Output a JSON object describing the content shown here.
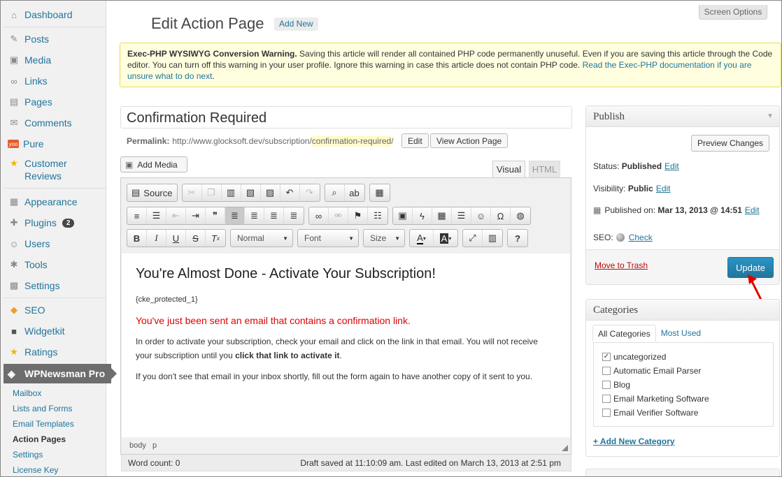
{
  "sidebar": {
    "items": [
      {
        "label": "Dashboard",
        "icon": "dashboard-icon",
        "glyph": "⌂"
      },
      {
        "label": "Posts",
        "icon": "pin-icon",
        "glyph": "✎"
      },
      {
        "label": "Media",
        "icon": "media-icon",
        "glyph": "▣"
      },
      {
        "label": "Links",
        "icon": "link-icon",
        "glyph": "∞"
      },
      {
        "label": "Pages",
        "icon": "pages-icon",
        "glyph": "▤"
      },
      {
        "label": "Comments",
        "icon": "comment-icon",
        "glyph": "✉"
      },
      {
        "label": "Pure",
        "icon": "yoo-icon",
        "glyph": "●"
      },
      {
        "label": "Customer",
        "label2": "Reviews",
        "icon": "star-icon",
        "glyph": "★"
      },
      {
        "label": "Appearance",
        "icon": "appearance-icon",
        "glyph": "▦"
      },
      {
        "label": "Plugins",
        "icon": "plugin-icon",
        "glyph": "✚",
        "badge": "2"
      },
      {
        "label": "Users",
        "icon": "users-icon",
        "glyph": "☺"
      },
      {
        "label": "Tools",
        "icon": "tools-icon",
        "glyph": "✱"
      },
      {
        "label": "Settings",
        "icon": "settings-icon",
        "glyph": "▩"
      },
      {
        "label": "SEO",
        "icon": "seo-icon",
        "glyph": "◆"
      },
      {
        "label": "Widgetkit",
        "icon": "widgetkit-icon",
        "glyph": "■"
      },
      {
        "label": "Ratings",
        "icon": "ratings-star-icon",
        "glyph": "★"
      }
    ],
    "active": {
      "label": "WPNewsman Pro",
      "icon": "newsman-icon"
    },
    "submenu": [
      "Mailbox",
      "Lists and Forms",
      "Email Templates",
      "Action Pages",
      "Settings",
      "License Key"
    ]
  },
  "header": {
    "screen_options": "Screen Options",
    "title": "Edit Action Page",
    "add_new": "Add New"
  },
  "warning": {
    "bold": "Exec-PHP WYSIWYG Conversion Warning.",
    "text": " Saving this article will render all contained PHP code permanently unuseful. Even if you are saving this article through the Code editor. You can turn off this warning in your user profile. Ignore this warning in case this article does not contain PHP code. ",
    "link": "Read the Exec-PHP documentation if you are unsure what to do next",
    "end": "."
  },
  "post": {
    "title": "Confirmation Required",
    "permalink_label": "Permalink:",
    "permalink_base": "http://www.glocksoft.dev/subscription/",
    "permalink_slug": "confirmation-required",
    "permalink_end": "/",
    "edit_btn": "Edit",
    "view_btn": "View Action Page"
  },
  "editor": {
    "add_media": "Add Media",
    "tab_visual": "Visual",
    "tab_html": "HTML",
    "source": "Source",
    "format": "Normal",
    "font": "Font",
    "size": "Size",
    "heading": "You're Almost Done - Activate Your Subscription!",
    "placeholder": "{cke_protected_1}",
    "red_line": "You've just been sent an email that contains a confirmation link.",
    "para1a": "In order to activate your subscription, check your email and click on the link in that email. You will not receive your subscription until you ",
    "para1b": "click that link to activate it",
    "para1c": ".",
    "para2": "If you don't see that email in your inbox shortly, fill out the form again to have another copy of it sent to you.",
    "path": "body   p",
    "word_count": "Word count: 0",
    "draft": "Draft saved at 11:10:09 am. Last edited on March 13, 2013 at 2:51 pm"
  },
  "publish": {
    "title": "Publish",
    "preview": "Preview Changes",
    "status_label": "Status:",
    "status_value": "Published",
    "visibility_label": "Visibility:",
    "visibility_value": "Public",
    "published_label": "Published on:",
    "published_value": "Mar 13, 2013 @ 14:51",
    "edit": "Edit",
    "seo_label": "SEO:",
    "seo_check": "Check",
    "trash": "Move to Trash",
    "update": "Update"
  },
  "categories": {
    "title": "Categories",
    "tab_all": "All Categories",
    "tab_used": "Most Used",
    "items": [
      {
        "label": "uncategorized",
        "checked": true
      },
      {
        "label": "Automatic Email Parser",
        "checked": false
      },
      {
        "label": "Blog",
        "checked": false
      },
      {
        "label": "Email Marketing Software",
        "checked": false
      },
      {
        "label": "Email Verifier Software",
        "checked": false
      }
    ],
    "add": "+ Add New Category"
  },
  "colors": {
    "link": "#21759b",
    "warning_bg": "#ffffe0",
    "update_btn": "#21759b",
    "red_text": "#e00000",
    "arrow": "#e00000"
  }
}
